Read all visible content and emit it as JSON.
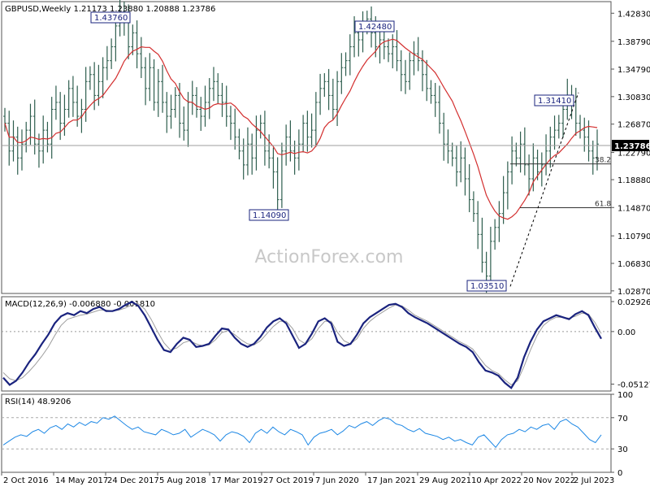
{
  "chart_data": [
    {
      "type": "candlestick",
      "panel": "price",
      "header": "GBPUSD,Weekly  1.21173 1.23880 1.20888 1.23786",
      "symbol": "GBPUSD",
      "timeframe": "Weekly",
      "ohlc_last": {
        "open": 1.21173,
        "high": 1.2388,
        "low": 1.20888,
        "close": 1.23786
      },
      "ylim": [
        1.025,
        1.445
      ],
      "y_ticks": [
        "1.42830",
        "1.38790",
        "1.34790",
        "1.30830",
        "1.26870",
        "1.22790",
        "1.18880",
        "1.14870",
        "1.10790",
        "1.06830",
        "1.02870"
      ],
      "current_price_label": "1.23786",
      "x_labels": [
        "2 Oct 2016",
        "14 May 2017",
        "24 Dec 2017",
        "5 Aug 2018",
        "17 Mar 2019",
        "27 Oct 2019",
        "7 Jun 2020",
        "17 Jan 2021",
        "29 Aug 2021",
        "10 Apr 2022",
        "20 Nov 2022",
        "2 Jul 2023"
      ],
      "annotations": [
        {
          "text": "1.43760",
          "x": "24 Dec 2017",
          "y": 1.4376
        },
        {
          "text": "1.42480",
          "x": "17 Jan 2021",
          "y": 1.4248
        },
        {
          "text": "1.31410",
          "x": "2 Jul 2023",
          "y": 1.3141
        },
        {
          "text": "1.14090",
          "x": "27 Oct 2019",
          "y": 1.1409
        },
        {
          "text": "1.03510",
          "x": "10 Apr 2022",
          "y": 1.0351
        }
      ],
      "fibonacci": [
        {
          "label": "38.2",
          "level": 1.2115
        },
        {
          "label": "61.8",
          "level": 1.1484
        }
      ],
      "close_series": [
        1.27,
        1.23,
        1.25,
        1.22,
        1.24,
        1.26,
        1.28,
        1.24,
        1.23,
        1.26,
        1.24,
        1.29,
        1.3,
        1.27,
        1.29,
        1.32,
        1.3,
        1.28,
        1.29,
        1.33,
        1.34,
        1.31,
        1.33,
        1.35,
        1.36,
        1.38,
        1.41,
        1.43,
        1.42,
        1.38,
        1.4,
        1.37,
        1.35,
        1.32,
        1.35,
        1.3,
        1.33,
        1.3,
        1.28,
        1.29,
        1.31,
        1.27,
        1.26,
        1.3,
        1.31,
        1.29,
        1.28,
        1.3,
        1.32,
        1.33,
        1.31,
        1.3,
        1.28,
        1.27,
        1.25,
        1.23,
        1.21,
        1.24,
        1.22,
        1.26,
        1.27,
        1.23,
        1.22,
        1.2,
        1.16,
        1.23,
        1.25,
        1.23,
        1.22,
        1.24,
        1.27,
        1.25,
        1.26,
        1.3,
        1.32,
        1.33,
        1.31,
        1.29,
        1.33,
        1.35,
        1.36,
        1.38,
        1.4,
        1.39,
        1.41,
        1.42,
        1.4,
        1.38,
        1.39,
        1.38,
        1.37,
        1.38,
        1.36,
        1.34,
        1.33,
        1.36,
        1.37,
        1.36,
        1.34,
        1.32,
        1.31,
        1.3,
        1.27,
        1.24,
        1.23,
        1.22,
        1.2,
        1.22,
        1.19,
        1.16,
        1.14,
        1.11,
        1.07,
        1.05,
        1.1,
        1.12,
        1.14,
        1.17,
        1.2,
        1.23,
        1.22,
        1.24,
        1.21,
        1.19,
        1.22,
        1.2,
        1.21,
        1.23,
        1.25,
        1.26,
        1.27,
        1.29,
        1.31,
        1.3,
        1.27,
        1.26,
        1.25,
        1.23,
        1.22,
        1.24
      ],
      "moving_average": {
        "description": "red line",
        "color": "#d32f2f"
      }
    },
    {
      "type": "line",
      "panel": "macd",
      "header": "MACD(12,26,9) -0.006880 -0.001810",
      "ylim": [
        -0.058,
        0.034
      ],
      "y_ticks": [
        "0.029261",
        "0.00",
        "-0.051279"
      ],
      "zero_label": "0.00",
      "series": [
        {
          "name": "MACD",
          "color": "#1a237e",
          "values": [
            -0.045,
            -0.052,
            -0.048,
            -0.04,
            -0.03,
            -0.022,
            -0.012,
            -0.003,
            0.008,
            0.015,
            0.018,
            0.016,
            0.02,
            0.018,
            0.022,
            0.024,
            0.02,
            0.02,
            0.022,
            0.026,
            0.029,
            0.025,
            0.016,
            0.004,
            -0.008,
            -0.018,
            -0.02,
            -0.012,
            -0.006,
            -0.008,
            -0.015,
            -0.014,
            -0.012,
            -0.004,
            0.003,
            0.002,
            -0.006,
            -0.012,
            -0.015,
            -0.012,
            -0.005,
            0.004,
            0.01,
            0.013,
            0.008,
            -0.004,
            -0.016,
            -0.012,
            -0.002,
            0.01,
            0.013,
            0.008,
            -0.01,
            -0.014,
            -0.012,
            -0.003,
            0.008,
            0.014,
            0.018,
            0.022,
            0.026,
            0.027,
            0.024,
            0.018,
            0.014,
            0.011,
            0.008,
            0.004,
            0.0,
            -0.004,
            -0.008,
            -0.012,
            -0.015,
            -0.02,
            -0.03,
            -0.038,
            -0.04,
            -0.043,
            -0.05,
            -0.055,
            -0.045,
            -0.025,
            -0.01,
            0.002,
            0.01,
            0.013,
            0.016,
            0.014,
            0.012,
            0.017,
            0.02,
            0.016,
            0.004,
            -0.007
          ]
        },
        {
          "name": "Signal",
          "color": "#9e9e9e",
          "values": [
            -0.04,
            -0.046,
            -0.048,
            -0.045,
            -0.039,
            -0.032,
            -0.024,
            -0.015,
            -0.004,
            0.006,
            0.012,
            0.014,
            0.016,
            0.017,
            0.019,
            0.021,
            0.021,
            0.02,
            0.021,
            0.023,
            0.026,
            0.027,
            0.022,
            0.012,
            0.0,
            -0.011,
            -0.018,
            -0.016,
            -0.011,
            -0.009,
            -0.012,
            -0.014,
            -0.013,
            -0.008,
            -0.001,
            0.001,
            -0.003,
            -0.008,
            -0.012,
            -0.013,
            -0.009,
            -0.002,
            0.005,
            0.01,
            0.01,
            0.003,
            -0.008,
            -0.012,
            -0.007,
            0.003,
            0.01,
            0.01,
            -0.001,
            -0.009,
            -0.012,
            -0.007,
            0.003,
            0.01,
            0.015,
            0.019,
            0.023,
            0.026,
            0.025,
            0.021,
            0.016,
            0.013,
            0.01,
            0.006,
            0.002,
            -0.002,
            -0.006,
            -0.01,
            -0.013,
            -0.017,
            -0.025,
            -0.033,
            -0.038,
            -0.041,
            -0.047,
            -0.052,
            -0.048,
            -0.034,
            -0.018,
            -0.004,
            0.006,
            0.011,
            0.014,
            0.014,
            0.013,
            0.015,
            0.018,
            0.017,
            0.009,
            -0.002
          ]
        }
      ]
    },
    {
      "type": "line",
      "panel": "rsi",
      "header": "RSI(14) 48.9206",
      "ylim": [
        0,
        100
      ],
      "y_ticks": [
        "100",
        "70",
        "30",
        "0"
      ],
      "levels": [
        70,
        30
      ],
      "series": [
        {
          "name": "RSI(14)",
          "color": "#1e88e5",
          "values": [
            35,
            40,
            45,
            48,
            46,
            52,
            55,
            50,
            57,
            60,
            55,
            62,
            58,
            64,
            60,
            65,
            63,
            70,
            68,
            72,
            66,
            60,
            55,
            58,
            52,
            50,
            48,
            55,
            52,
            48,
            50,
            55,
            45,
            50,
            55,
            52,
            48,
            40,
            48,
            52,
            50,
            46,
            38,
            50,
            55,
            50,
            58,
            52,
            48,
            55,
            52,
            48,
            35,
            45,
            50,
            52,
            55,
            48,
            53,
            60,
            57,
            62,
            65,
            60,
            66,
            70,
            68,
            62,
            60,
            55,
            52,
            56,
            50,
            48,
            46,
            42,
            45,
            40,
            42,
            38,
            35,
            45,
            48,
            40,
            32,
            42,
            48,
            50,
            55,
            52,
            58,
            55,
            60,
            62,
            55,
            65,
            68,
            62,
            58,
            50,
            42,
            38,
            48
          ]
        }
      ]
    }
  ],
  "watermark": "ActionForex.com"
}
